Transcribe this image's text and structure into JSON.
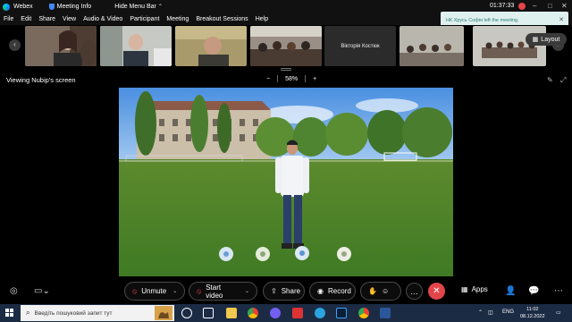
{
  "titlebar": {
    "app_name": "Webex",
    "meeting_info": "Meeting Info",
    "hide_menu": "Hide Menu Bar",
    "timer": "01:37:33"
  },
  "menu": [
    "File",
    "Edit",
    "Share",
    "View",
    "Audio & Video",
    "Participant",
    "Meeting",
    "Breakout Sessions",
    "Help"
  ],
  "toast": {
    "message": "НК Хрусь Софія  left the meeting."
  },
  "participants": {
    "name_tile": "Вікторія Костюк",
    "layout_label": "Layout"
  },
  "viewing": {
    "label": "Viewing Nubip's screen",
    "zoom": "58%"
  },
  "controls": {
    "unmute": "Unmute",
    "start_video": "Start video",
    "share": "Share",
    "record": "Record",
    "apps": "Apps"
  },
  "taskbar": {
    "search_placeholder": "Введіть пошуковий запит тут",
    "lang": "ENG",
    "time": "11:02",
    "date": "08.12.2022"
  },
  "colors": {
    "accent_red": "#e2454a",
    "toast_bg": "#dff1ef",
    "taskbar": "#1c2b44"
  }
}
